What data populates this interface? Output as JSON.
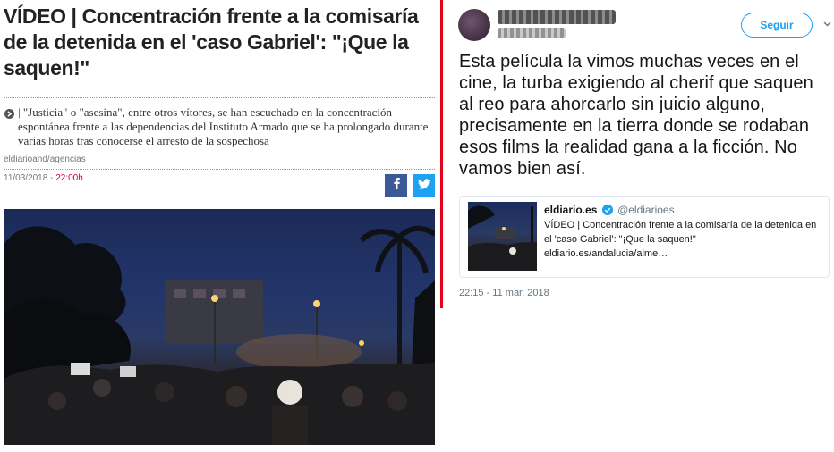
{
  "article": {
    "headline": "VÍDEO | Concentración frente a la comisaría de la detenida en el 'caso Gabriel': \"¡Que la saquen!\"",
    "summary": "| \"Justicia\" o \"asesina\", entre otros vítores, se han escuchado en la concentración espontánea frente a las dependencias del Instituto Armado que se ha prolongado durante varias horas tras conocerse el arresto de la sospechosa",
    "source": "eldiarioand/agencias",
    "date": "11/03/2018 - ",
    "time": "22:00h",
    "share": [
      "facebook-icon",
      "twitter-icon"
    ],
    "colors": {
      "time": "#d4002c",
      "facebook": "#3b5998",
      "twitter": "#1da1f2",
      "divider": "#e3001b"
    }
  },
  "tweet": {
    "follow_label": "Seguir",
    "text": "Esta película la vimos muchas veces en el cine, la turba exigiendo al cherif que saquen al reo para ahorcarlo sin juicio alguno, precisamente en la tierra donde se rodaban esos films la realidad gana a la ficción. No vamos bien así.",
    "quote": {
      "name": "eldiario.es",
      "handle": "@eldiarioes",
      "text": "VÍDEO | Concentración frente a la comisaría de la detenida en el 'caso Gabriel': \"¡Que la saquen!\" eldiario.es/andalucia/alme…"
    },
    "timestamp": "22:15 - 11 mar. 2018",
    "colors": {
      "accent": "#1da1f2",
      "muted": "#657786"
    }
  }
}
